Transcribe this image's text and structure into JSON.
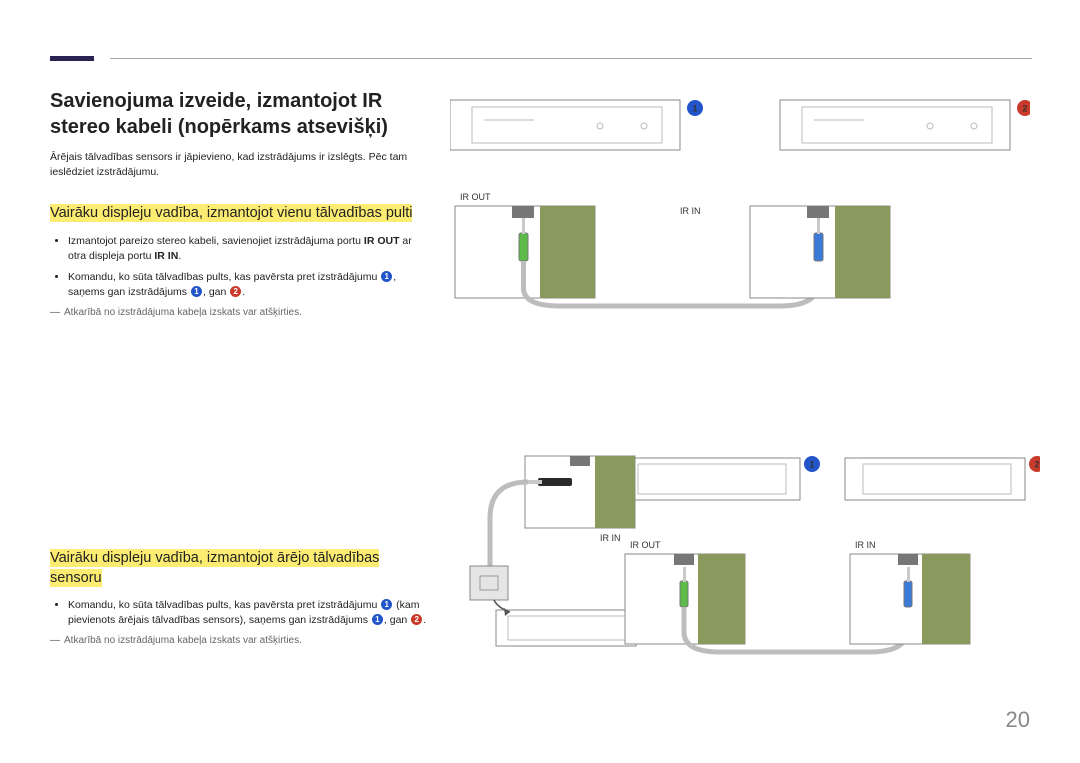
{
  "page_number": "20",
  "title": "Savienojuma izveide, izmantojot IR stereo kabeli (nopērkams atsevišķi)",
  "intro": "Ārējais tālvadības sensors ir jāpievieno, kad izstrādājums ir izslēgts. Pēc tam ieslēdziet izstrādājumu.",
  "section1": {
    "heading": "Vairāku displeju vadība, izmantojot vienu tālvadības pulti",
    "bullet1_a": "Izmantojot pareizo stereo kabeli, savienojiet izstrādājuma portu ",
    "bullet1_ir_out": "IR OUT",
    "bullet1_b": " ar otra displeja portu ",
    "bullet1_ir_in": "IR IN",
    "bullet1_c": ".",
    "bullet2_a": "Komandu, ko sūta tālvadības pults, kas pavērsta pret izstrādājumu ",
    "bullet2_b": ", saņems gan izstrādājums ",
    "bullet2_c": ", gan ",
    "bullet2_d": ".",
    "footnote": "Atkarībā no izstrādājuma kabeļa izskats var atšķirties."
  },
  "section2": {
    "heading": "Vairāku displeju vadība, izmantojot ārējo tālvadības sensoru",
    "bullet1_a": "Komandu, ko sūta tālvadības pults, kas pavērsta pret izstrādājumu ",
    "bullet1_b": " (kam pievienots ārējais tālvadības sensors), saņems gan izstrādājums ",
    "bullet1_c": ", gan ",
    "bullet1_d": ".",
    "footnote": "Atkarībā no izstrādājuma kabeļa izskats var atšķirties."
  },
  "labels": {
    "ir_out": "IR OUT",
    "ir_in": "IR IN"
  },
  "badges": {
    "one": "1",
    "two": "2"
  }
}
